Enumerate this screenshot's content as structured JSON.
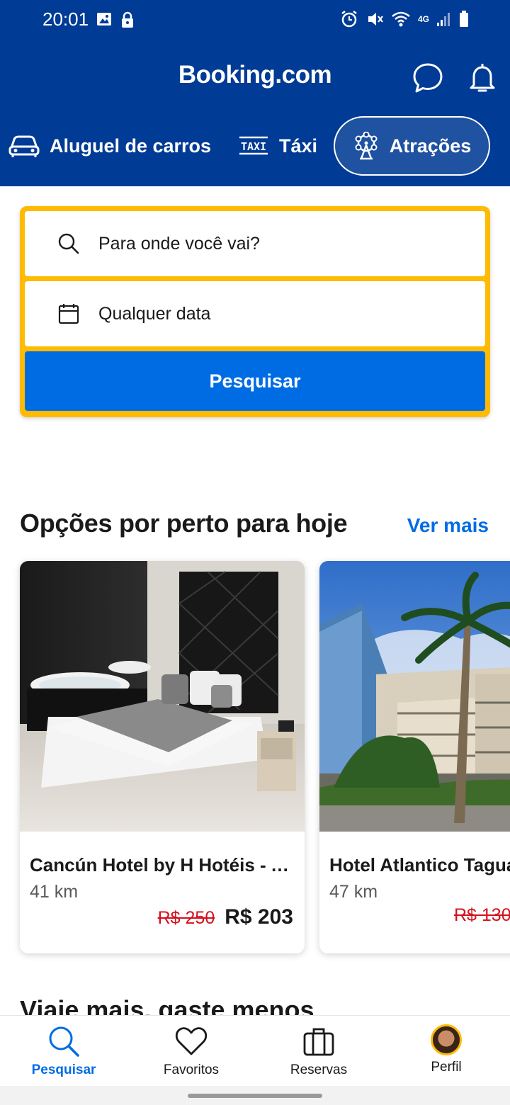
{
  "status_bar": {
    "time": "20:01",
    "network": "4G"
  },
  "header": {
    "logo": "Booking.com",
    "categories": [
      {
        "label": "Aluguel de carros",
        "icon": "car-icon"
      },
      {
        "label": "Táxi",
        "icon": "taxi-icon"
      },
      {
        "label": "Atrações",
        "icon": "ferris-wheel-icon",
        "selected": true
      }
    ]
  },
  "search": {
    "destination_placeholder": "Para onde você vai?",
    "date_placeholder": "Qualquer data",
    "button_label": "Pesquisar"
  },
  "nearby": {
    "title": "Opções por perto para hoje",
    "see_more": "Ver mais",
    "hotels": [
      {
        "name": "Cancún Hotel by H Hotéis - Ai...",
        "distance": "41 km",
        "old_price": "R$ 250",
        "price": "R$ 203"
      },
      {
        "name": "Hotel Atlantico Tagua",
        "distance": "47 km",
        "old_price": "R$ 130",
        "price": ""
      }
    ]
  },
  "next_section": {
    "title": "Viaje mais, gaste menos"
  },
  "bottom_nav": {
    "items": [
      {
        "label": "Pesquisar",
        "icon": "search-icon",
        "active": true
      },
      {
        "label": "Favoritos",
        "icon": "heart-icon"
      },
      {
        "label": "Reservas",
        "icon": "briefcase-icon"
      },
      {
        "label": "Perfil",
        "icon": "avatar"
      }
    ]
  },
  "colors": {
    "brand_blue": "#003b95",
    "action_blue": "#006ce4",
    "search_yellow": "#febb02",
    "discount_red": "#d4111e"
  }
}
